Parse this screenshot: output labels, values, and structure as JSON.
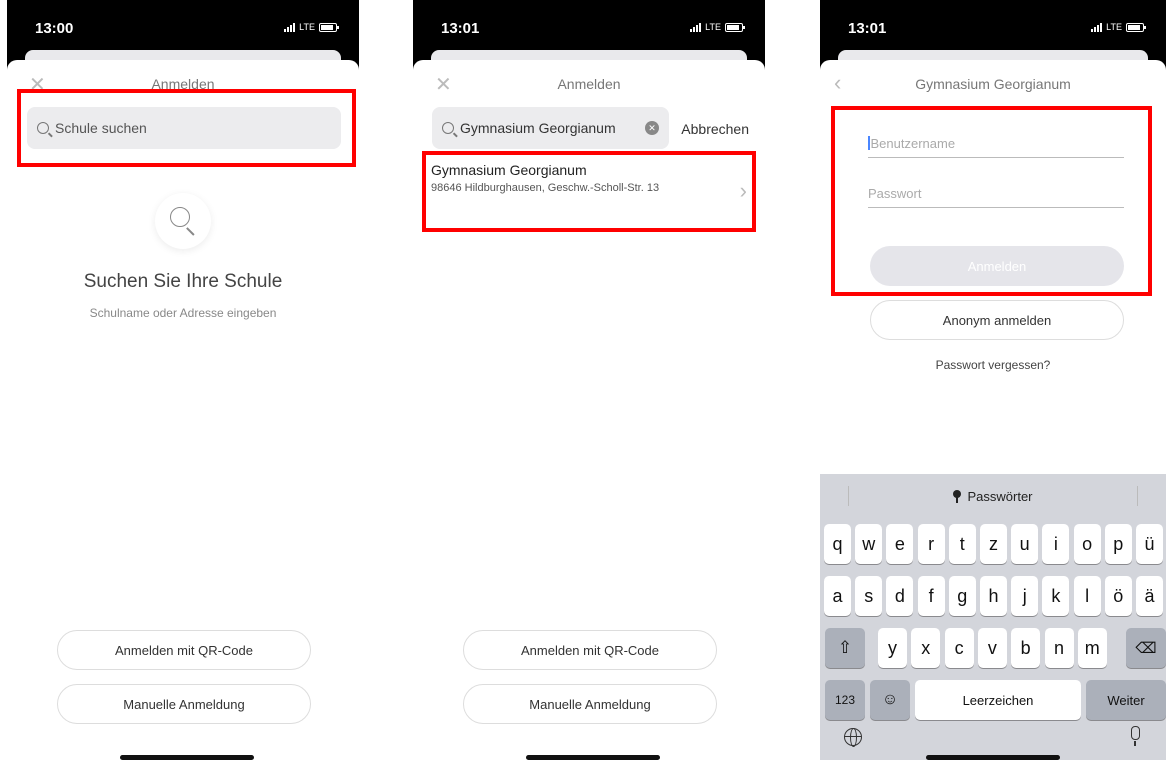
{
  "screen1": {
    "time": "13:00",
    "network": "LTE",
    "title": "Anmelden",
    "search_placeholder": "Schule suchen",
    "empty_title": "Suchen Sie Ihre Schule",
    "empty_subtitle": "Schulname oder Adresse eingeben",
    "qr_button": "Anmelden mit QR-Code",
    "manual_button": "Manuelle Anmeldung"
  },
  "screen2": {
    "time": "13:01",
    "network": "LTE",
    "title": "Anmelden",
    "search_value": "Gymnasium Georgianum",
    "cancel": "Abbrechen",
    "result_name": "Gymnasium Georgianum",
    "result_address": "98646 Hildburghausen, Geschw.-Scholl-Str. 13",
    "qr_button": "Anmelden mit QR-Code",
    "manual_button": "Manuelle Anmeldung"
  },
  "screen3": {
    "time": "13:01",
    "network": "LTE",
    "title": "Gymnasium Georgianum",
    "username_placeholder": "Benutzername",
    "password_placeholder": "Passwort",
    "login_button": "Anmelden",
    "anon_button": "Anonym anmelden",
    "forgot": "Passwort vergessen?",
    "kb_passwords": "Passwörter",
    "row1": [
      "q",
      "w",
      "e",
      "r",
      "t",
      "z",
      "u",
      "i",
      "o",
      "p",
      "ü"
    ],
    "row2": [
      "a",
      "s",
      "d",
      "f",
      "g",
      "h",
      "j",
      "k",
      "l",
      "ö",
      "ä"
    ],
    "row3": [
      "y",
      "x",
      "c",
      "v",
      "b",
      "n",
      "m"
    ],
    "key_123": "123",
    "key_space": "Leerzeichen",
    "key_next": "Weiter"
  },
  "icons": {
    "close": "close-icon",
    "back": "chevron-left-icon",
    "search": "search-icon",
    "shift": "shift-icon",
    "delete": "backspace-icon",
    "emoji": "emoji-icon",
    "globe": "globe-icon",
    "mic": "microphone-icon",
    "key": "key-icon"
  },
  "colors": {
    "highlight": "#ff0000",
    "caret": "#4a86ff"
  }
}
